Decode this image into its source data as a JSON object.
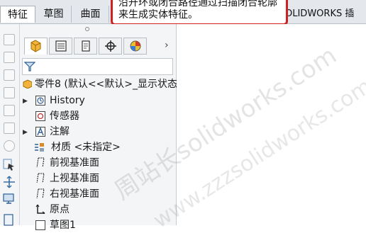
{
  "tabs": {
    "features": "特征",
    "sketch": "草图",
    "surface": "曲面",
    "plugins": "OLIDWORKS 插件"
  },
  "tooltip": {
    "line1": "沿开环或闭合路径通过扫描闭合轮廓",
    "line2": "来生成实体特征。"
  },
  "feature_tree": {
    "root": "零件8 (默认<<默认>_显示状态",
    "items": [
      {
        "label": "History",
        "icon": "history-icon",
        "expandable": true
      },
      {
        "label": "传感器",
        "icon": "sensor-icon",
        "expandable": false
      },
      {
        "label": "注解",
        "icon": "annotation-icon",
        "expandable": true
      },
      {
        "label": "材质 <未指定>",
        "icon": "material-icon",
        "expandable": false
      },
      {
        "label": "前视基准面",
        "icon": "plane-icon",
        "expandable": false
      },
      {
        "label": "上视基准面",
        "icon": "plane-icon",
        "expandable": false
      },
      {
        "label": "右视基准面",
        "icon": "plane-icon",
        "expandable": false
      },
      {
        "label": "原点",
        "icon": "origin-icon",
        "expandable": false
      },
      {
        "label": "草图1",
        "icon": "sketch-icon",
        "expandable": false
      }
    ]
  },
  "panel_more": "›",
  "watermark": "周站长solidworks.com",
  "watermark2": "www.zzzsolidworks.com",
  "colors": {
    "tooltip_border": "#cc2222",
    "tab_bar": "#e4e8ed",
    "panel_bg": "#f4f5f7"
  }
}
